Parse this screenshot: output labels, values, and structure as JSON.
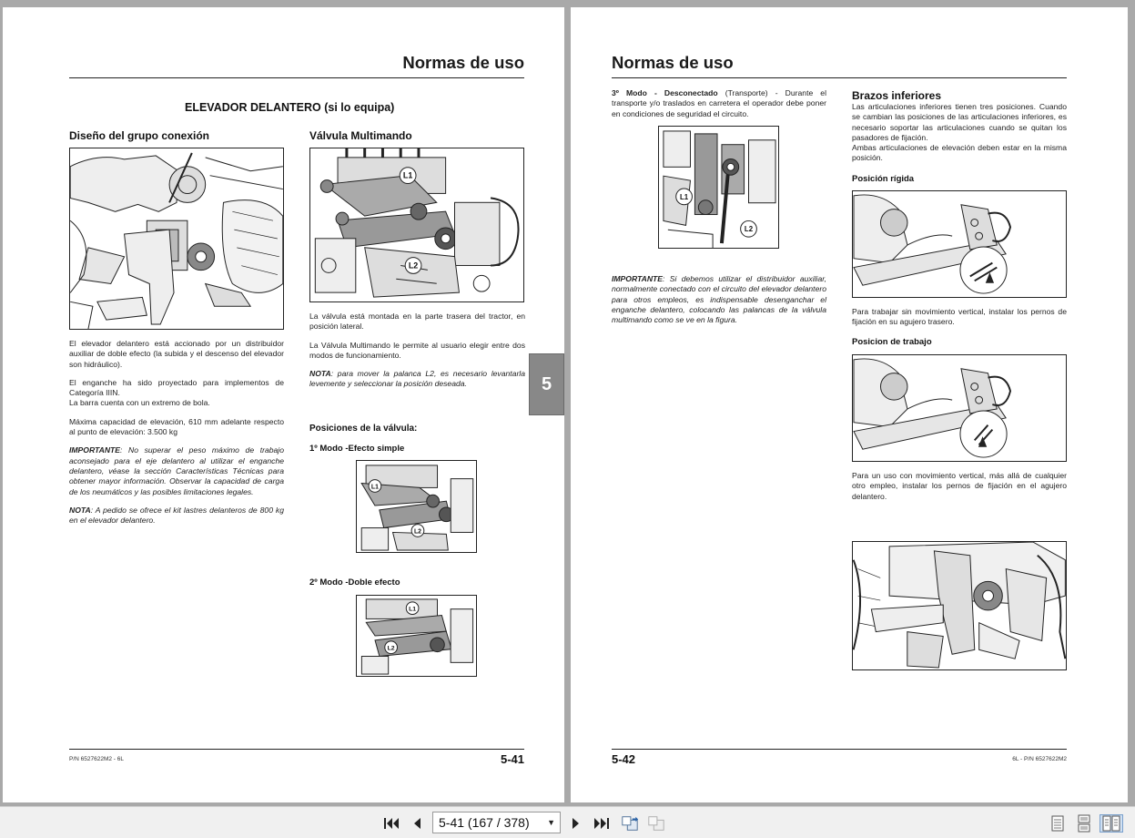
{
  "left_page": {
    "header_title": "Normas de uso",
    "section_title": "ELEVADOR DELANTERO (si lo equipa)",
    "col1": {
      "heading": "Diseño del grupo conexión",
      "p1": "El elevador delantero está accionado por un distribuidor auxiliar de doble efecto (la subida y el descenso del elevador son hidráulico).",
      "p2a": "El enganche ha sido proyectado para implementos de Categoría IIIN.",
      "p2b": "La barra cuenta con un extremo de bola.",
      "p3": "Máxima capacidad de elevación, 610 mm adelante respecto al punto de elevación: 3.500 kg",
      "important_label": "IMPORTANTE",
      "important_text": ": No superar el peso máximo de trabajo aconsejado para el eje delantero al utilizar el enganche delantero, véase la sección Características Técnicas para obtener mayor información. Observar la capacidad de carga de los neumáticos y las posibles limitaciones legales.",
      "nota_label": "NOTA",
      "nota_text": ": A pedido se ofrece el kit lastres delanteros de 800 kg en el elevador delantero."
    },
    "col2": {
      "heading": "Válvula Multimando",
      "p1": "La válvula está montada en la parte trasera del tractor, en posición lateral.",
      "p2": "La Válvula Multimando le permite al usuario elegir entre dos modos de funcionamiento.",
      "nota_label": "NOTA",
      "nota_text": ": para mover la palanca L2, es necesario levantarla levemente y seleccionar la posición deseada.",
      "positions_heading": "Posiciones de la válvula:",
      "mode1": "1º Modo -Efecto simple",
      "mode2": "2º Modo -Doble efecto"
    },
    "footer_left": "P/N 6527622M2 - 6L",
    "footer_page": "5-41"
  },
  "section_tab": "5",
  "right_page": {
    "header_title": "Normas de uso",
    "col1": {
      "mode3_label": "3º Modo - Desconectado",
      "mode3_text": " (Transporte) - Durante el transporte y/o traslados en carretera el operador debe poner en condiciones de seguridad el circuito.",
      "important_label": "IMPORTANTE",
      "important_text": ": Si debemos utilizar el distribuidor auxiliar, normalmente conectado con el circuito del elevador delantero para otros empleos, es indispensable desenganchar el enganche delantero, colocando las palancas de la válvula multimando como se ve en la figura."
    },
    "col2": {
      "heading": "Brazos inferiores",
      "p1": "Las articulaciones inferiores tienen tres posiciones. Cuando se cambian las posiciones de las articulaciones inferiores, es necesario soportar las articulaciones cuando se quitan los pasadores de fijación.",
      "p2": "Ambas articulaciones de elevación deben estar en la misma posición.",
      "rigid_heading": "Posición rígida",
      "rigid_text": "Para trabajar sin movimiento vertical, instalar los pernos de fijación en su agujero trasero.",
      "work_heading": "Posicion de trabajo",
      "work_text": "Para un uso con movimiento vertical, más allá de cualquier otro empleo, instalar los pernos de fijación en el agujero delantero."
    },
    "footer_page": "5-42",
    "footer_right": "6L - P/N 6527622M2"
  },
  "figure_labels": {
    "l1": "L1",
    "l2": "L2"
  },
  "toolbar": {
    "page_selector": "5-41 (167 / 378)",
    "icons": [
      "first-page-icon",
      "prev-page-icon",
      "next-page-icon",
      "last-page-icon",
      "back-icon",
      "forward-icon",
      "single-page-icon",
      "continuous-icon",
      "two-page-icon"
    ]
  }
}
